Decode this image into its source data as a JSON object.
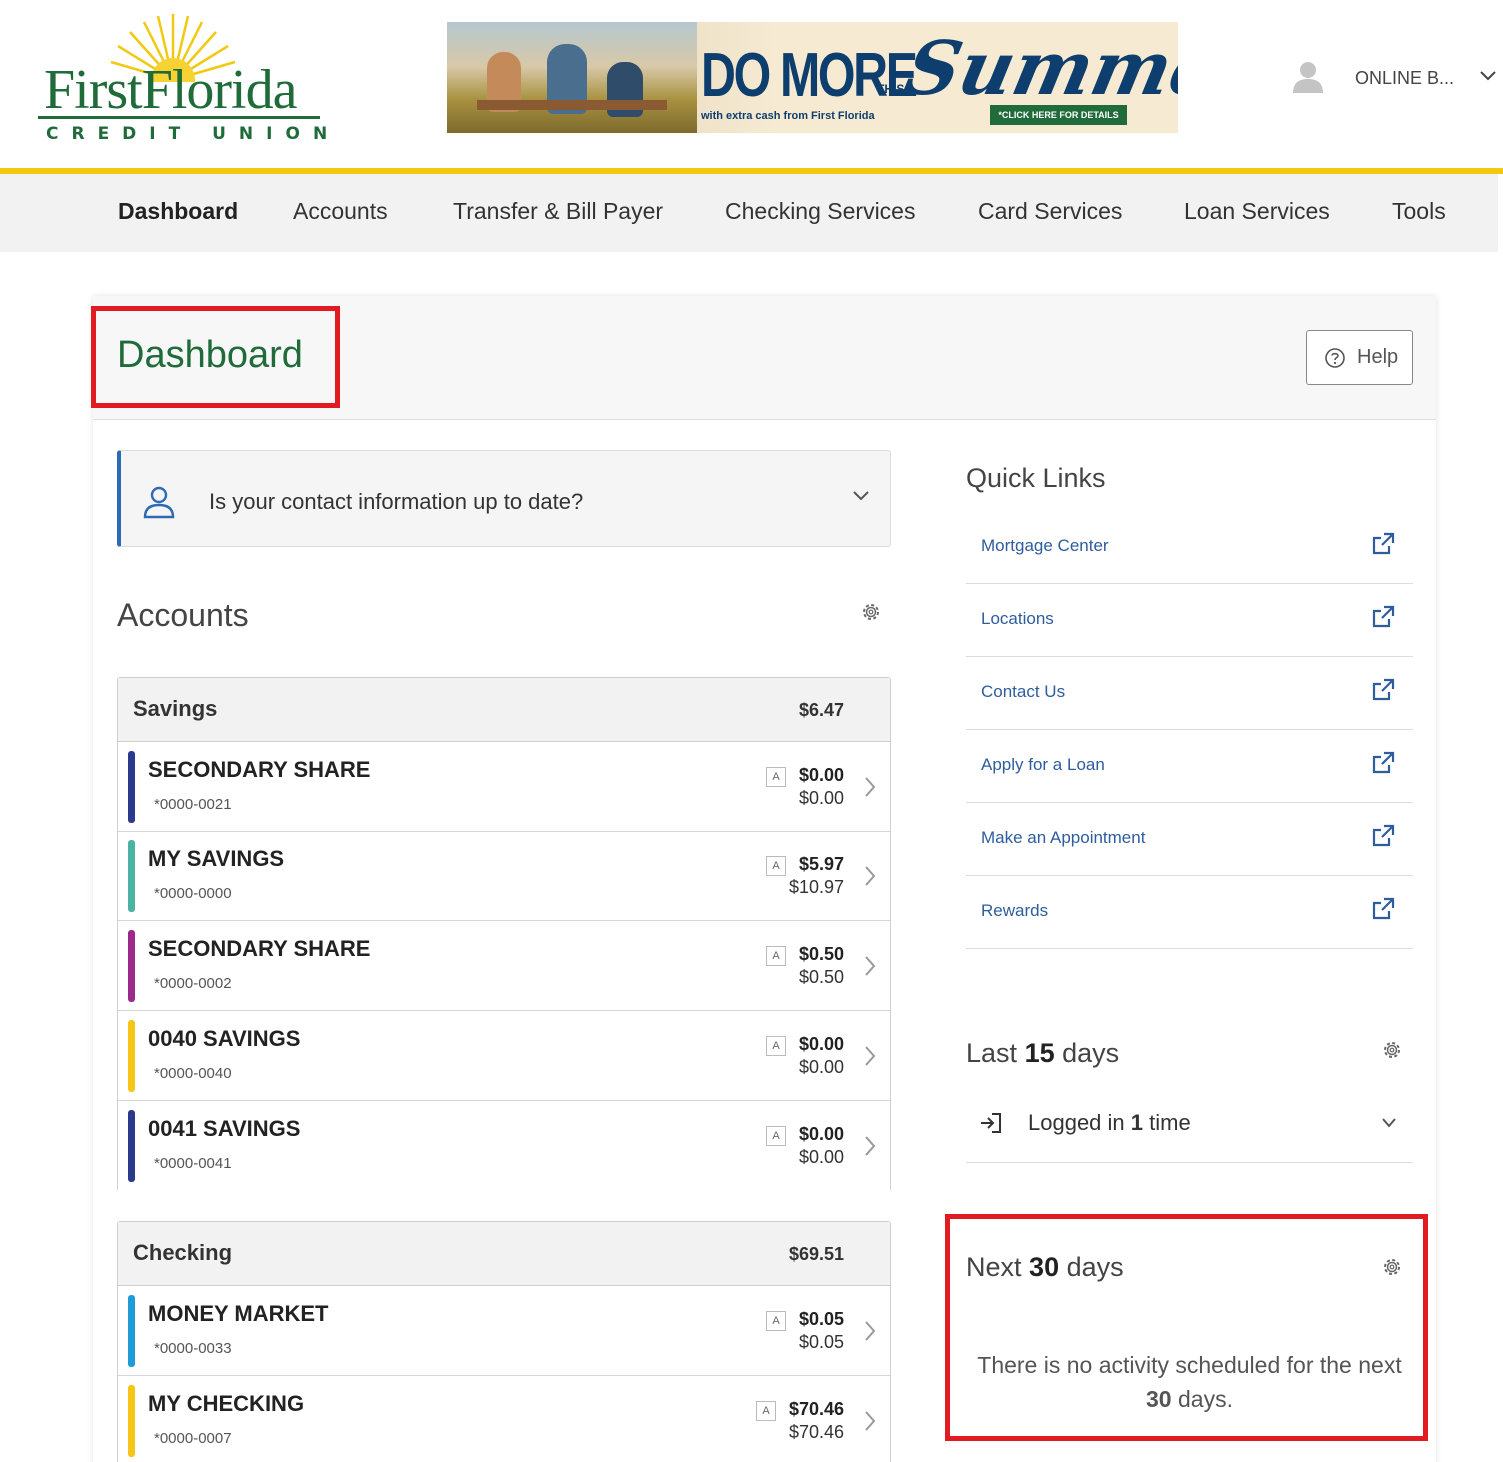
{
  "brand": {
    "logo_name": "FirstFlorida",
    "logo_sub": "CREDIT UNION",
    "colors": {
      "brand_green": "#1f6b3a",
      "accent_yellow": "#f2c811",
      "link_blue": "#2e5d9e",
      "highlight_red": "#e21b23"
    }
  },
  "banner": {
    "headline": "DO MORE",
    "this": "THIS",
    "summer": "Summer!",
    "tagline": "with extra cash from First Florida",
    "cta": "*CLICK HERE FOR DETAILS"
  },
  "user": {
    "label": "ONLINE B...",
    "icon": "user-icon"
  },
  "nav": {
    "items": [
      {
        "label": "Dashboard",
        "active": true
      },
      {
        "label": "Accounts"
      },
      {
        "label": "Transfer & Bill Payer"
      },
      {
        "label": "Checking Services"
      },
      {
        "label": "Card Services"
      },
      {
        "label": "Loan Services"
      },
      {
        "label": "Tools"
      }
    ]
  },
  "page": {
    "title": "Dashboard",
    "help_label": "Help"
  },
  "contact_prompt": {
    "text": "Is your contact information up to date?"
  },
  "accounts": {
    "title": "Accounts",
    "groups": [
      {
        "name": "Savings",
        "total": "$6.47",
        "items": [
          {
            "name": "SECONDARY SHARE",
            "number": "*0000-0021",
            "badge": "A",
            "available": "$0.00",
            "current": "$0.00",
            "color": "#2b3a8c"
          },
          {
            "name": "MY SAVINGS",
            "number": "*0000-0000",
            "badge": "A",
            "available": "$5.97",
            "current": "$10.97",
            "color": "#4bb3a2"
          },
          {
            "name": "SECONDARY SHARE",
            "number": "*0000-0002",
            "badge": "A",
            "available": "$0.50",
            "current": "$0.50",
            "color": "#9b2a8a"
          },
          {
            "name": "0040 SAVINGS",
            "number": "*0000-0040",
            "badge": "A",
            "available": "$0.00",
            "current": "$0.00",
            "color": "#f5c518"
          },
          {
            "name": "0041 SAVINGS",
            "number": "*0000-0041",
            "badge": "A",
            "available": "$0.00",
            "current": "$0.00",
            "color": "#2b3a8c"
          }
        ]
      },
      {
        "name": "Checking",
        "total": "$69.51",
        "items": [
          {
            "name": "MONEY MARKET",
            "number": "*0000-0033",
            "badge": "A",
            "available": "$0.05",
            "current": "$0.05",
            "color": "#1f9bd7"
          },
          {
            "name": "MY CHECKING",
            "number": "*0000-0007",
            "badge": "A",
            "available": "$70.46",
            "current": "$70.46",
            "color": "#f5c518"
          }
        ]
      }
    ]
  },
  "quick_links": {
    "title": "Quick Links",
    "items": [
      {
        "label": "Mortgage Center"
      },
      {
        "label": "Locations"
      },
      {
        "label": "Contact Us"
      },
      {
        "label": "Apply for a Loan"
      },
      {
        "label": "Make an Appointment"
      },
      {
        "label": "Rewards"
      }
    ]
  },
  "last_days": {
    "prefix": "Last",
    "count": "15",
    "suffix": "days",
    "login_prefix": "Logged in",
    "login_count": "1",
    "login_suffix": "time"
  },
  "next_days": {
    "prefix": "Next",
    "count": "30",
    "suffix": "days",
    "msg_part1": "There is no activity scheduled for the next",
    "msg_count": "30",
    "msg_part2": "days."
  }
}
